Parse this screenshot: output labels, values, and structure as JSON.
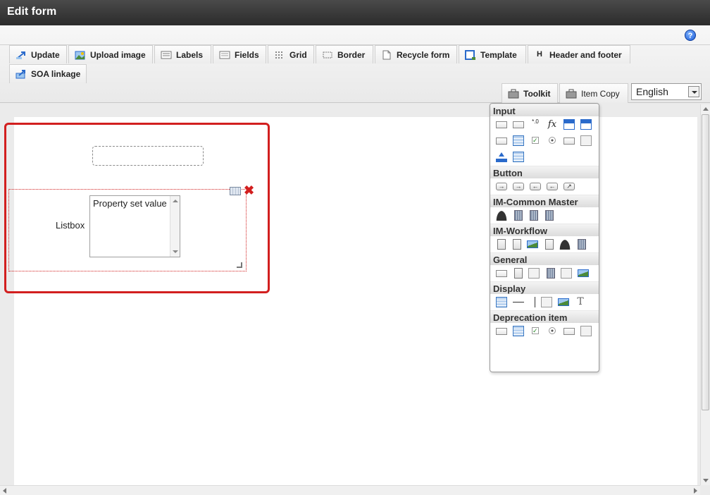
{
  "window": {
    "title": "Edit form"
  },
  "help": {
    "glyph": "?"
  },
  "toolbar": {
    "buttons": [
      {
        "label": "Update",
        "icon": "update-icon"
      },
      {
        "label": "Upload image",
        "icon": "upload-image-icon"
      },
      {
        "label": "Labels",
        "icon": "labels-icon"
      },
      {
        "label": "Fields",
        "icon": "fields-icon"
      },
      {
        "label": "Grid",
        "icon": "grid-icon"
      },
      {
        "label": "Border",
        "icon": "border-icon"
      },
      {
        "label": "Recycle form",
        "icon": "recycle-form-icon"
      },
      {
        "label": "Template",
        "icon": "template-icon"
      },
      {
        "label": "Header and footer",
        "icon": "header-footer-icon",
        "glyph": "H"
      },
      {
        "label": "SOA linkage",
        "icon": "soa-linkage-icon"
      }
    ],
    "toolkit_label": "Toolkit",
    "item_copy_label": "Item Copy",
    "language": {
      "selected": "English"
    }
  },
  "form": {
    "item": {
      "label": "Listbox",
      "listbox_value": "Property set value"
    },
    "delete_glyph": "✖"
  },
  "palette": {
    "sections": [
      {
        "title": "Input",
        "icons": [
          "text-field-icon",
          "text-area-icon",
          "number-field-icon",
          "formula-icon",
          "calendar-icon",
          "date-range-icon",
          "select-box-icon",
          "listbox-icon",
          "checkbox-icon",
          "radio-button-icon",
          "hidden-field-icon",
          "table-field-icon",
          "file-upload-icon",
          "grid-field-icon"
        ]
      },
      {
        "title": "Button",
        "icons": [
          "submit-button-icon",
          "next-button-icon",
          "back-button-icon",
          "previous-button-icon",
          "forward-button-icon"
        ]
      },
      {
        "title": "IM-Common Master",
        "icons": [
          "user-icon",
          "company-icon",
          "department-icon",
          "organization-icon"
        ]
      },
      {
        "title": "IM-Workflow",
        "icons": [
          "workflow-form-icon",
          "attachment-icon",
          "workflow-image-icon",
          "history-icon",
          "approver-icon",
          "stamp-icon"
        ]
      },
      {
        "title": "General",
        "icons": [
          "dotted-field-icon",
          "document-icon",
          "camera-icon",
          "key-icon",
          "panel-icon",
          "media-icon"
        ]
      },
      {
        "title": "Display",
        "icons": [
          "label-icon",
          "horizontal-line-icon",
          "vertical-line-icon",
          "rectangle-icon",
          "image-icon",
          "text-icon"
        ]
      },
      {
        "title": "Deprecation item",
        "icons": [
          "select-box-icon",
          "listbox-icon",
          "checkbox-icon",
          "radio-button-icon",
          "hidden-field-icon",
          "table-field-icon"
        ]
      }
    ],
    "glyphs": {
      "formula": "fx",
      "number": "*.0",
      "text": "T",
      "check": "✓"
    }
  },
  "colors": {
    "titlebar": "#2b2b2b",
    "highlight": "#d21f1f",
    "accent": "#2a6acb"
  }
}
